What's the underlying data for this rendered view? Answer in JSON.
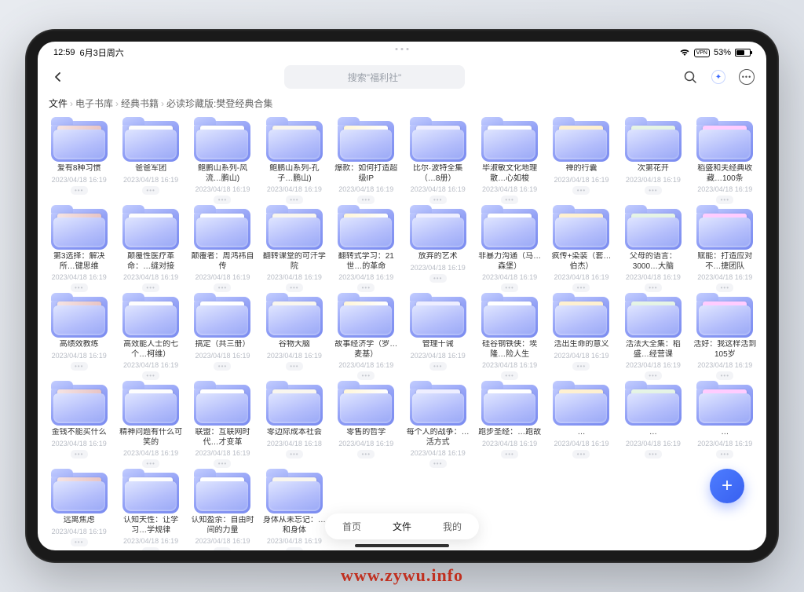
{
  "status": {
    "time": "12:59",
    "date": "6月3日周六",
    "vpn": "VPN",
    "battery_pct": "53%"
  },
  "search": {
    "placeholder": "搜索\"福利社\""
  },
  "breadcrumb": {
    "root": "文件",
    "parts": [
      "电子书库",
      "经典书籍",
      "必读珍藏版:樊登经典合集"
    ]
  },
  "tabs": {
    "home": "首页",
    "files": "文件",
    "me": "我的"
  },
  "default_date": "2023/04/18 16:19",
  "folders": [
    {
      "title": "爱有8种习惯"
    },
    {
      "title": "爸爸军团"
    },
    {
      "title": "鲍鹏山系列-风流…鹏山)"
    },
    {
      "title": "鲍鹏山系列-孔子…鹏山)"
    },
    {
      "title": "爆款：如何打造超级IP"
    },
    {
      "title": "比尔·波特全集（…8册）"
    },
    {
      "title": "毕淑敏文化地理散…心如梭"
    },
    {
      "title": "禅的行囊"
    },
    {
      "title": "次第花开"
    },
    {
      "title": "稻盛和夫经典收藏…100条"
    },
    {
      "title": "第3选择：解决所…键思维"
    },
    {
      "title": "颠覆性医疗革命：…缝对接"
    },
    {
      "title": "颠覆者：周鸿祎自传"
    },
    {
      "title": "翻转课堂的可汗学院"
    },
    {
      "title": "翻转式学习：21世…的革命"
    },
    {
      "title": "放弃的艺术"
    },
    {
      "title": "非暴力沟通（马…森堡）"
    },
    {
      "title": "疯传+染装（套…伯杰）"
    },
    {
      "title": "父母的语言：3000…大脑"
    },
    {
      "title": "赋能：打造应对不…捷团队"
    },
    {
      "title": "高绩效教练"
    },
    {
      "title": "高效能人士的七个…柯维）"
    },
    {
      "title": "搞定（共三册）"
    },
    {
      "title": "谷物大脑"
    },
    {
      "title": "故事经济学（罗…麦基）"
    },
    {
      "title": "管理十诫"
    },
    {
      "title": "硅谷钢铁侠：埃隆…险人生"
    },
    {
      "title": "活出生命的意义"
    },
    {
      "title": "活法大全集：稻盛…经营课"
    },
    {
      "title": "活好：我这样活到105岁"
    },
    {
      "title": "金钱不能买什么"
    },
    {
      "title": "精神问题有什么可笑的"
    },
    {
      "title": "联盟：互联网时代…才变革"
    },
    {
      "title": "零边际成本社会",
      "date": "2023/04/18 16:18"
    },
    {
      "title": "零售的哲学"
    },
    {
      "title": "每个人的战争：…活方式"
    },
    {
      "title": "跑步圣经：…跑故"
    },
    {
      "title": "…"
    },
    {
      "title": "…"
    },
    {
      "title": "…"
    },
    {
      "title": "远离焦虑"
    },
    {
      "title": "认知天性：让学习…学规律"
    },
    {
      "title": "认知盈余：自由时间的力量"
    },
    {
      "title": "身体从未忘记：…和身体"
    }
  ],
  "watermark": "www.zywu.info"
}
